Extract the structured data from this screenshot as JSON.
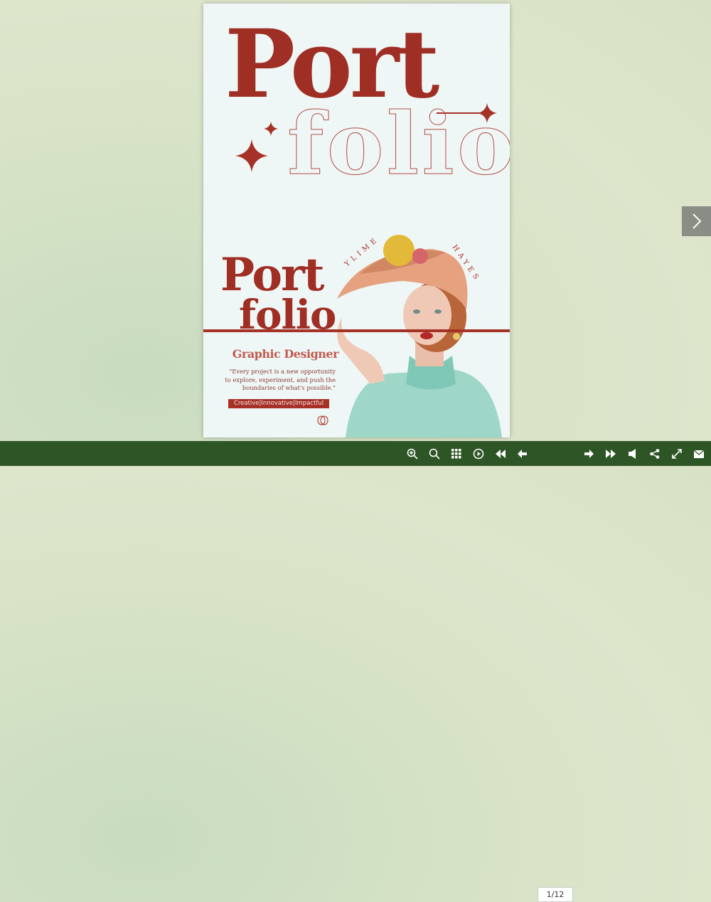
{
  "page": {
    "title_large_top": "Port",
    "title_large_bottom": "folio",
    "title_small_top": "Port",
    "title_small_bottom": "folio",
    "arc_name_left": "YLIME",
    "arc_name_right": "HAYES",
    "role": "Graphic Designer",
    "quote_lines": [
      "\"Every project is a new opportunity",
      "to explore, experiment, and push the",
      "boundaries of what's possible.\""
    ],
    "tags": "Creative|Innovative|Impactful"
  },
  "toolbar": {
    "page_indicator": "1/12",
    "buttons": [
      "zoom-in-icon",
      "search-icon",
      "thumbnails-icon",
      "autoplay-icon",
      "first-page-icon",
      "previous-page-icon",
      "next-page-icon",
      "last-page-icon",
      "sound-icon",
      "share-icon",
      "fullscreen-icon",
      "email-icon"
    ]
  },
  "colors": {
    "accent": "#a63127",
    "toolbar": "#2e5526",
    "page_bg": "#eff7f6"
  }
}
